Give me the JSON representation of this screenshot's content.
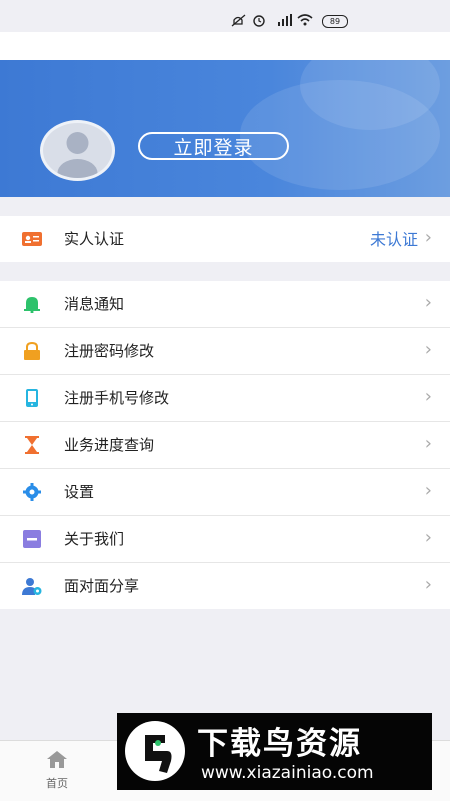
{
  "status_bar": {
    "battery": "89"
  },
  "profile": {
    "login_button": "立即登录"
  },
  "verification": {
    "label": "实人认证",
    "value": "未认证"
  },
  "menu": [
    {
      "label": "消息通知",
      "icon": "bell-icon",
      "color": "#2dc26b"
    },
    {
      "label": "注册密码修改",
      "icon": "lock-icon",
      "color": "#f0a020"
    },
    {
      "label": "注册手机号修改",
      "icon": "phone-icon",
      "color": "#26b5e0"
    },
    {
      "label": "业务进度查询",
      "icon": "hourglass-icon",
      "color": "#f07030"
    },
    {
      "label": "设置",
      "icon": "gear-icon",
      "color": "#2a8de8"
    },
    {
      "label": "关于我们",
      "icon": "info-icon",
      "color": "#8a7de0"
    },
    {
      "label": "面对面分享",
      "icon": "share-user-icon",
      "color": "#3d79d4"
    }
  ],
  "tab_bar": {
    "home_label": "首页"
  },
  "watermark": {
    "title": "下载鸟资源",
    "url": "www.xiazainiao.com"
  },
  "colors": {
    "accent": "#3d79d4",
    "background": "#efeff4"
  }
}
